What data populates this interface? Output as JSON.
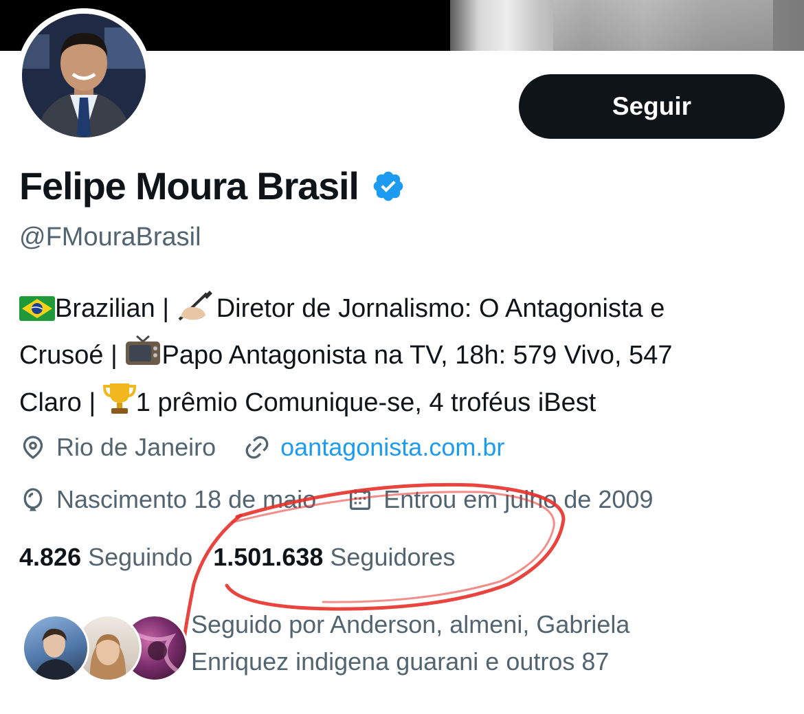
{
  "header": {
    "follow_label": "Seguir"
  },
  "profile": {
    "name": "Felipe Moura Brasil",
    "handle": "@FMouraBrasil",
    "verified": true,
    "bio_line1": "Brazilian | ",
    "bio_line1b": "Diretor de Jornalismo: O Antagonista e",
    "bio_line2a": "Crusoé | ",
    "bio_line2b": "Papo Antagonista na TV, 18h: 579 Vivo, 547",
    "bio_line3a": "Claro | ",
    "bio_line3b": "1 prêmio Comunique-se, 4 troféus iBest",
    "location": "Rio de Janeiro",
    "website": "oantagonista.com.br",
    "birthday": "Nascimento 18 de maio",
    "joined": "Entrou em julho de 2009"
  },
  "stats": {
    "following_count": "4.826",
    "following_label": "Seguindo",
    "followers_count": "1.501.638",
    "followers_label": "Seguidores"
  },
  "followed_by": {
    "line1": "Seguido por Anderson, almeni, Gabriela",
    "line2": "Enriquez indigena guarani e outros 87"
  },
  "colors": {
    "accent": "#1d9bf0",
    "text_primary": "#0f1419",
    "text_secondary": "#536471",
    "annotation": "#e8302a"
  },
  "icons": [
    "verified-badge-icon",
    "location-pin-icon",
    "link-icon",
    "balloon-icon",
    "calendar-icon",
    "brazil-flag-icon",
    "writing-hand-icon",
    "television-icon",
    "trophy-icon"
  ]
}
